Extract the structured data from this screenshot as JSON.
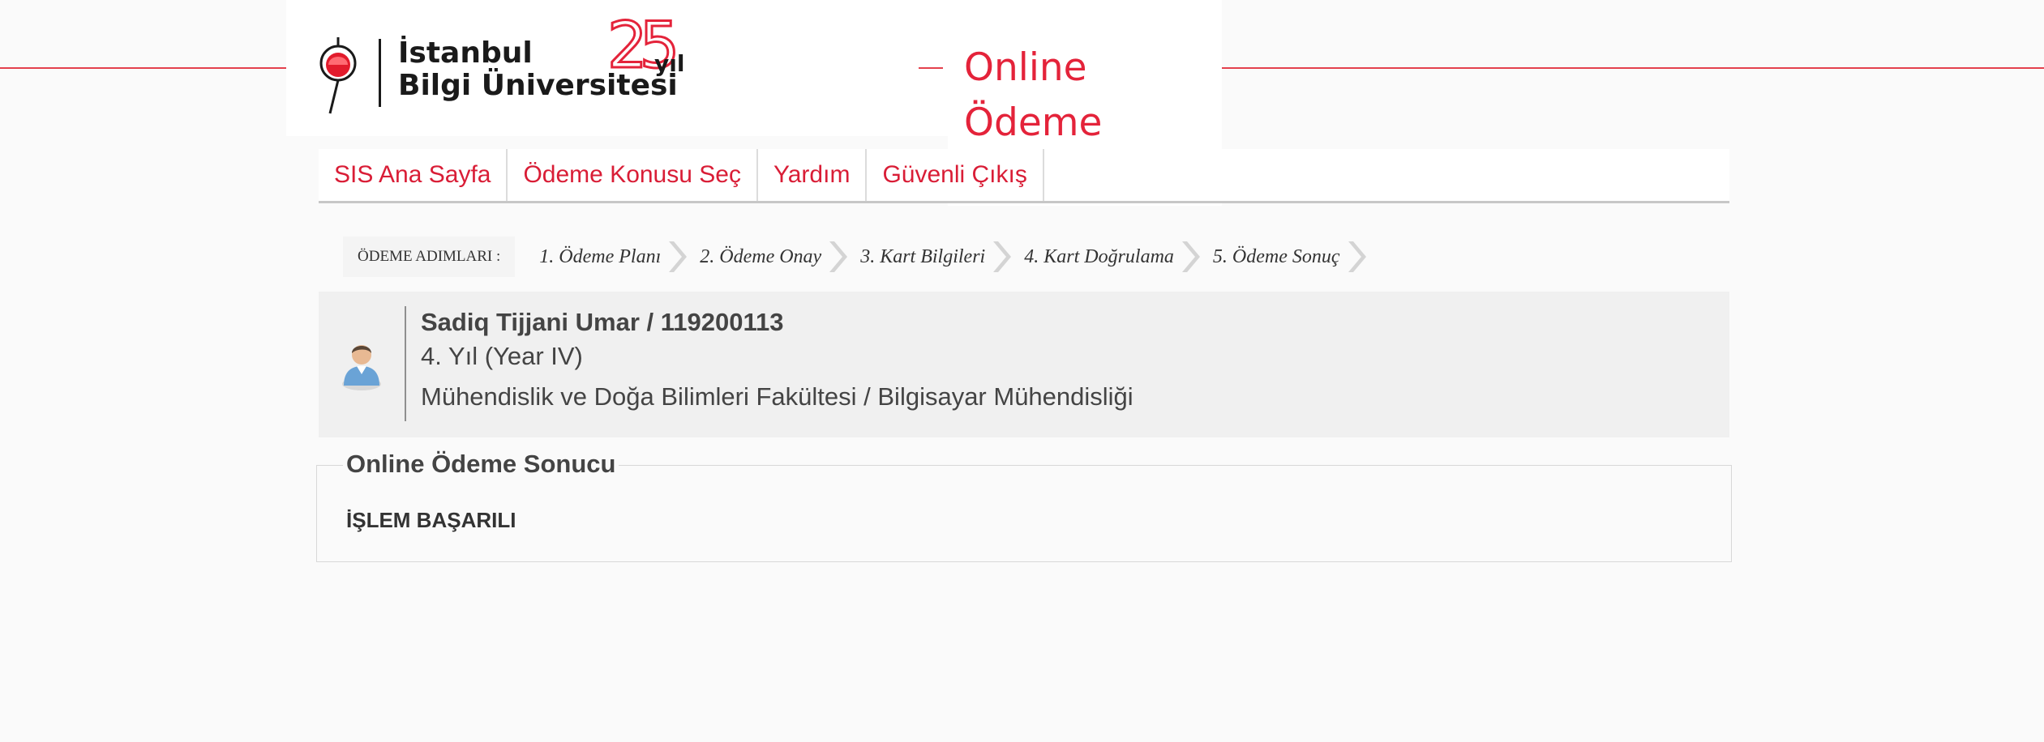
{
  "header": {
    "logo_line1": "İstanbul",
    "logo_line2": "Bilgi Üniversitesi",
    "anniversary_number": "25",
    "anniversary_word": "yıl",
    "title": "Online Ödeme Sistemi",
    "accent_color": "#e4233a"
  },
  "nav": {
    "items": [
      {
        "label": "SIS Ana Sayfa"
      },
      {
        "label": "Ödeme Konusu Seç"
      },
      {
        "label": "Yardım"
      },
      {
        "label": "Güvenli Çıkış"
      }
    ]
  },
  "steps": {
    "label": "ÖDEME ADIMLARI :",
    "items": [
      {
        "label": "1. Ödeme Planı"
      },
      {
        "label": "2. Ödeme Onay"
      },
      {
        "label": "3. Kart Bilgileri"
      },
      {
        "label": "4. Kart Doğrulama"
      },
      {
        "label": "5. Ödeme Sonuç"
      }
    ]
  },
  "student": {
    "name_id": "Sadiq Tijjani Umar / 119200113",
    "year": "4. Yıl (Year IV)",
    "department": "Mühendislik ve Doğa Bilimleri Fakültesi / Bilgisayar Mühendisliği",
    "avatar_icon": "user-avatar-icon"
  },
  "result": {
    "title": "Online Ödeme Sonucu",
    "status": "İŞLEM BAŞARILI"
  }
}
